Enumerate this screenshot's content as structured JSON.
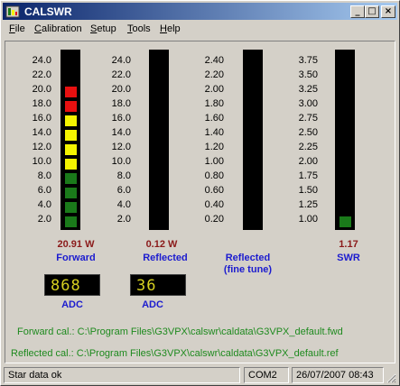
{
  "window": {
    "title": "CALSWR"
  },
  "titlebar_buttons": {
    "minimize": "_",
    "maximize": "□",
    "close": "×"
  },
  "menu": [
    {
      "label": "File",
      "underline": "F",
      "rest": "ile"
    },
    {
      "label": "Calibration",
      "underline": "C",
      "rest": "alibration"
    },
    {
      "label": "Setup",
      "underline": "S",
      "rest": "etup"
    },
    {
      "label": "Tools",
      "underline": "T",
      "rest": "ools"
    },
    {
      "label": "Help",
      "underline": "H",
      "rest": "elp"
    }
  ],
  "meters": [
    {
      "label": "Forward",
      "value": "20.91 W",
      "scale": [
        "24.0",
        "22.0",
        "20.0",
        "18.0",
        "16.0",
        "14.0",
        "12.0",
        "10.0",
        "8.0",
        "6.0",
        "4.0",
        "2.0"
      ],
      "lit_segments": 10
    },
    {
      "label": "Reflected",
      "value": "0.12 W",
      "scale": [
        "24.0",
        "22.0",
        "20.0",
        "18.0",
        "16.0",
        "14.0",
        "12.0",
        "10.0",
        "8.0",
        "6.0",
        "4.0",
        "2.0"
      ],
      "lit_segments": 0
    },
    {
      "label": "Reflected\n(fine tune)",
      "value": "",
      "scale": [
        "2.40",
        "2.20",
        "2.00",
        "1.80",
        "1.60",
        "1.40",
        "1.20",
        "1.00",
        "0.80",
        "0.60",
        "0.40",
        "0.20"
      ],
      "lit_segments": 0
    },
    {
      "label": "SWR",
      "value": "1.17",
      "scale": [
        "3.75",
        "3.50",
        "3.25",
        "3.00",
        "2.75",
        "2.50",
        "2.25",
        "2.00",
        "1.75",
        "1.50",
        "1.25",
        "1.00"
      ],
      "lit_segments": 1
    }
  ],
  "segment_colors": {
    "green": "#1a7a1a",
    "yellow": "#f4f400",
    "red": "#e81010",
    "lcd": "#d6d020"
  },
  "adc": [
    {
      "display": "868",
      "label": "ADC"
    },
    {
      "display": "36",
      "label": "ADC"
    }
  ],
  "calibration": {
    "forward": "Forward cal.: C:\\Program Files\\G3VPX\\calswr\\caldata\\G3VPX_default.fwd",
    "reflected": "Reflected cal.: C:\\Program Files\\G3VPX\\calswr\\caldata\\G3VPX_default.ref"
  },
  "status": {
    "message": "Star data ok",
    "port": "COM2",
    "datetime": "26/07/2007 08:43"
  }
}
